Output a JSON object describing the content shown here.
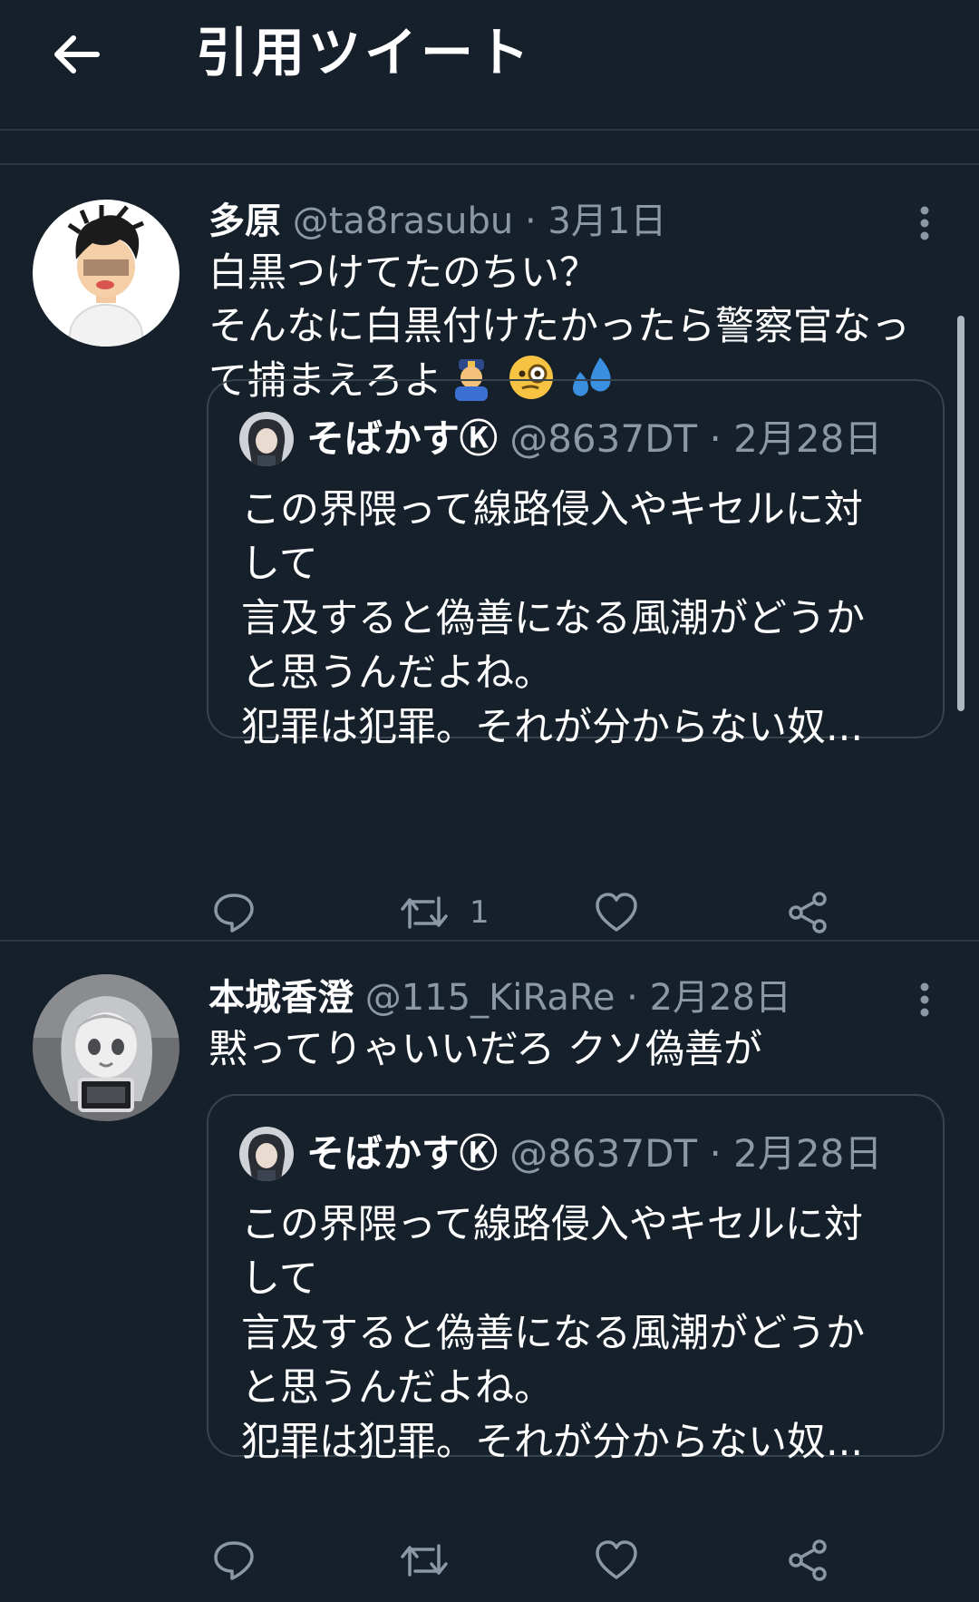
{
  "header": {
    "title": "引用ツイート"
  },
  "tweets": [
    {
      "name": "多原",
      "handle": "@ta8rasubu",
      "date": "3月1日",
      "lines": [
        "白黒つけてたのちい？",
        "そんなに白黒付けたかったら警察官なっ",
        "て捕まえろよ"
      ],
      "emojis": [
        "police-officer-emoji",
        "face-with-monocle-emoji",
        "sweat-droplets-emoji"
      ],
      "quoted": {
        "name": "そばかすⓀ",
        "handle": "@8637DT",
        "date": "2月28日",
        "lines": [
          "この界隈って線路侵入やキセルに対",
          "して",
          "言及すると偽善になる風潮がどうか",
          "と思うんだよね。",
          "犯罪は犯罪。それが分からない奴..."
        ]
      },
      "retweet_count": "1"
    },
    {
      "name": "本城香澄",
      "handle": "@115_KiRaRe",
      "date": "2月28日",
      "lines": [
        "黙ってりゃいいだろ クソ偽善が"
      ],
      "quoted": {
        "name": "そばかすⓀ",
        "handle": "@8637DT",
        "date": "2月28日",
        "lines": [
          "この界隈って線路侵入やキセルに対",
          "して",
          "言及すると偽善になる風潮がどうか",
          "と思うんだよね。",
          "犯罪は犯罪。それが分からない奴..."
        ]
      }
    }
  ],
  "colors": {
    "background": "#15202b",
    "muted": "#8b98a5",
    "border": "#38444d"
  },
  "icons": [
    "back-arrow-icon",
    "more-icon",
    "reply-icon",
    "retweet-icon",
    "like-icon",
    "share-icon"
  ]
}
